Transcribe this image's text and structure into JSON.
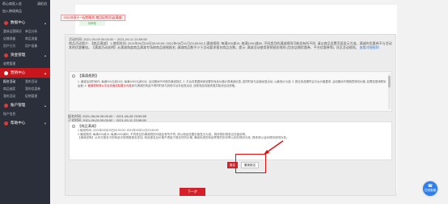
{
  "sidebar": {
    "top_rows": [
      "帮心商家入驻",
      "清柜机",
      "加入跨境商品"
    ],
    "sections": [
      {
        "label": "数据中心",
        "active": false,
        "items": [
          "整体运营情况",
          "单品分析",
          "店铺流量",
          "商品流量",
          "用户行为",
          "用户画像"
        ]
      },
      {
        "label": "资金管理",
        "active": false,
        "items": [
          "收费管理"
        ]
      },
      {
        "label": "营销中心",
        "active": true,
        "items": [
          "报名活动",
          "我的活动",
          "商品抽奖",
          "我的优惠券",
          "我的活动",
          "促销管理"
        ]
      },
      {
        "label": "账户管理",
        "active": false,
        "items": [
          "账户信息"
        ]
      },
      {
        "label": "帮助中心",
        "active": false,
        "items": []
      }
    ]
  },
  "activity": {
    "tab_label": "2021年双十一促销报名-商品促销活动(满减)",
    "status": "待审核",
    "time_line": "活动时间: 2021-09-09 00:00:00 ~ 2021-09-11 23:59:59",
    "desc": "商品活动简介: 【商品满减】 1.使用时间: 2021年09月09日00:00:00~2021年09月11日23:59:59 2.满减规则: 每满200减15, 每满1000减50, 不同类目的满减规则可能会有所不同, 请以商品设置页面显示为准。满减的优惠券不与活动其他优惠叠加。【满减活动说明】从满减角度商品满减专场按商品规格报名, 满减商品数不少于活动要求报名商品总数。提示: 满减活动使用营销抵扣规则 (包含店铺优惠券、平台优惠券等), 详见活动规则。",
    "desc_link": "查看详细规则",
    "rules": {
      "title": "【满减规则】",
      "text": "1. 满减活动时间内, 每满200元减15元, 每满1000元减50元, 活动期间不可修改满减档位; 2. 平台将根据商家设置的商品价格计算满减优惠, 若同时参与店铺优惠活动, 以最低价为准; 3. 报名商品需符合平台价格要求, 活动期间不得随意修改价格, 如需变更请联系运营; 4. ",
      "highlight": "营销规则请以平台页面实际展示为准",
      "text2": "参与满减的商品不得同时参与其他平台补贴类活动, 违规商品将被清退并取消活动资格。"
    },
    "signup_time": "报名时间: 2021-08-06 00:00:00 ~ 2021-08-28 23:59:59",
    "formal_time": "正式时间: 2021-09-09 00:00:00 ~ 2021-09-11 23:59:59",
    "promo": {
      "title": "【商品满减】",
      "line1": "1.使用时间: 2021年09月09日00:00:00~2021年09月11日23:59:59",
      "line2": "2.满减规则: 每满200减15, 每满1000减50, 不同类目的满减规则可能会有所不同, 请以商品设置页面显示为准。具体规则请参见页面说明。",
      "line3_prefix": "【满减说明】",
      "line3": "从本次报名中的商品中按规格报名参加, 商品报名后价格不得高于报名时的价格, 满减优惠的商品享受的折扣率以实际规则为准, 具体请以活动规则说明为准。"
    }
  },
  "buttons": {
    "confirm": "报名",
    "cancel_signup": "撤销报名",
    "next": "下一步"
  },
  "fab": {
    "label": "在线客服"
  },
  "colors": {
    "accent": "#d5202a",
    "sidebar_bg": "#2b2f3a",
    "sidebar_active": "#c8161d",
    "link": "#2c7be5",
    "fab": "#2f80ed",
    "highlight_box": "#e01111"
  }
}
